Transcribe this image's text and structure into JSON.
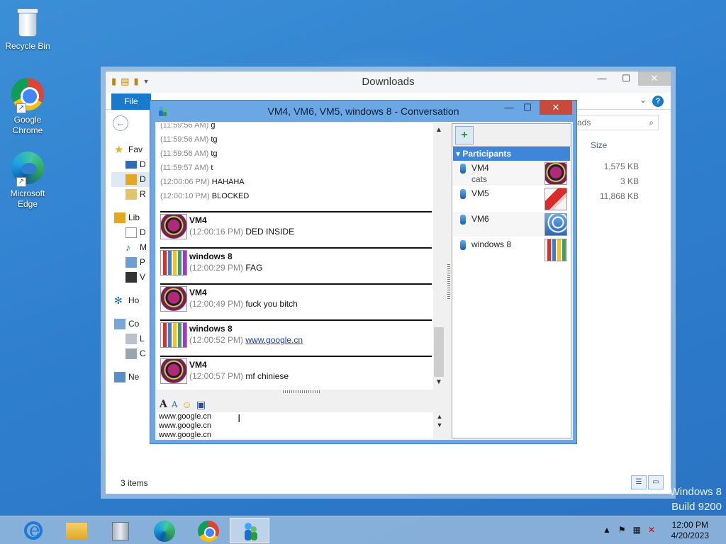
{
  "desktop": {
    "icons": [
      {
        "label": "Recycle Bin"
      },
      {
        "label": "Google Chrome"
      },
      {
        "label": "Microsoft Edge"
      }
    ],
    "watermark": {
      "line1": "Windows 8",
      "line2": "Build 9200"
    }
  },
  "explorer": {
    "title": "Downloads",
    "file_tab": "File",
    "search_partial": "ads",
    "size_header": "Size",
    "nav_items": [
      "Fav",
      "D",
      "D",
      "R",
      "Lib",
      "D",
      "M",
      "P",
      "V",
      "Ho",
      "Co",
      "L",
      "C",
      "Ne"
    ],
    "sizes": [
      "1,575 KB",
      "3 KB",
      "11,868 KB"
    ],
    "status": "3 items"
  },
  "conversation": {
    "title": "VM4, VM6, VM5, windows 8 - Conversation",
    "system_lines": [
      {
        "ts": "(11:59:56 AM)",
        "text": "g"
      },
      {
        "ts": "(11:59:56 AM)",
        "text": "tg"
      },
      {
        "ts": "(11:59:56 AM)",
        "text": "tg"
      },
      {
        "ts": "(11:59:57 AM)",
        "text": "t"
      },
      {
        "ts": "(12:00:06 PM)",
        "text": "HAHAHA"
      },
      {
        "ts": "(12:00:10 PM)",
        "text": "BLOCKED"
      }
    ],
    "messages": [
      {
        "sender": "VM4",
        "ts": "(12:00:16 PM)",
        "text": "DED INSIDE",
        "avatar": "ball"
      },
      {
        "sender": "windows 8",
        "ts": "(12:00:29 PM)",
        "text": "FAG",
        "avatar": "crayons"
      },
      {
        "sender": "VM4",
        "ts": "(12:00:49 PM)",
        "text": "fuck you bitch",
        "avatar": "ball"
      },
      {
        "sender": "windows 8",
        "ts": "(12:00:52 PM)",
        "text": "www.google.cn",
        "avatar": "crayons",
        "is_link": true
      },
      {
        "sender": "VM4",
        "ts": "(12:00:57 PM)",
        "text": "mf chiniese",
        "avatar": "ball"
      }
    ],
    "input_lines": [
      "www.google.cn",
      "www.google.cn",
      "www.google.cn"
    ],
    "participants_header": "Participants",
    "participants": [
      {
        "name": "VM4",
        "status": "cats",
        "avatar": "ball"
      },
      {
        "name": "VM5",
        "status": "",
        "avatar": "crane"
      },
      {
        "name": "VM6",
        "status": "",
        "avatar": "wheel"
      },
      {
        "name": "windows 8",
        "status": "",
        "avatar": "crayons"
      }
    ]
  },
  "taskbar": {
    "clock_time": "12:00 PM",
    "clock_date": "4/20/2023"
  }
}
